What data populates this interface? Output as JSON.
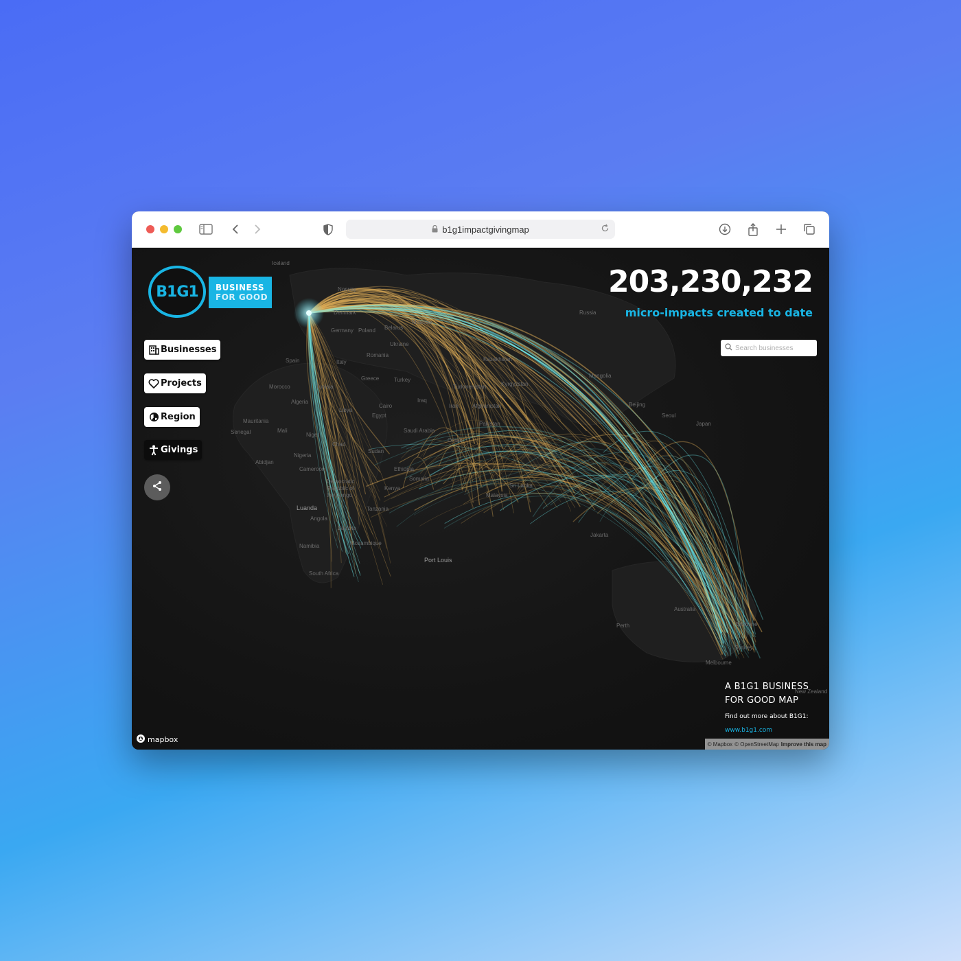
{
  "browser": {
    "url": "b1g1impactgivingmap",
    "icons": [
      "sidebar-icon",
      "back-icon",
      "forward-icon",
      "shield-icon",
      "lock-icon",
      "reload-icon",
      "download-icon",
      "share-icon",
      "new-tab-icon",
      "tabs-icon"
    ]
  },
  "logo": {
    "mark": "B1G1",
    "line1": "BUSINESS",
    "line2": "FOR GOOD"
  },
  "nav": {
    "items": [
      {
        "label": "Businesses",
        "icon": "building-icon"
      },
      {
        "label": "Projects",
        "icon": "heart-icon"
      },
      {
        "label": "Region",
        "icon": "globe-icon"
      },
      {
        "label": "Givings",
        "icon": "person-icon"
      }
    ],
    "share_icon": "share-icon"
  },
  "counter": {
    "value": "203,230,232",
    "label": "micro-impacts created to date"
  },
  "search": {
    "placeholder": "Search businesses"
  },
  "places": [
    "Iceland",
    "Norway",
    "Denmark",
    "Germany",
    "Poland",
    "Belarus",
    "Moscow",
    "Ukraine",
    "Romania",
    "Spain",
    "Italy",
    "Greece",
    "Turkey",
    "Kazakhstan",
    "Russia",
    "Mongolia",
    "Morocco",
    "Tunisia",
    "Algeria",
    "Libya",
    "Egypt",
    "Cairo",
    "Iraq",
    "Iran",
    "Turkmenistan",
    "Kyrgyzstan",
    "Afghanistan",
    "Pakistan",
    "Beijing",
    "Seoul",
    "Japan",
    "Mauritania",
    "Senegal",
    "Mali",
    "Niger",
    "Chad",
    "Sudan",
    "Saudi Arabia",
    "Oman",
    "Abidjan",
    "Nigeria",
    "Cameroon",
    "Ethiopia",
    "Somalia",
    "Democratic Republic of the Congo",
    "Kenya",
    "Tanzania",
    "Sri Lanka",
    "Malaysia",
    "Luanda",
    "Angola",
    "Zambia",
    "Mozambique",
    "Namibia",
    "South Africa",
    "Port Louis",
    "Jakarta",
    "Australia",
    "Perth",
    "Brisbane",
    "Sydney",
    "Melbourne",
    "New Zealand"
  ],
  "footer": {
    "title_line1": "A B1G1 BUSINESS",
    "title_line2": "FOR GOOD MAP",
    "text": "Find out more about B1G1:",
    "link": "www.b1g1.com"
  },
  "mapbox": {
    "logo_text": "mapbox",
    "attribution_1": "© Mapbox",
    "attribution_2": "© OpenStreetMap",
    "attribution_3": "Improve this map"
  },
  "colors": {
    "accent": "#19b5e4",
    "arc_gold": "#e8b45a",
    "arc_cyan": "#6ff2f5"
  }
}
